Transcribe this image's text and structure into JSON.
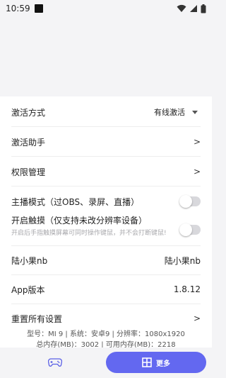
{
  "status_bar": {
    "time": "10:59"
  },
  "settings": {
    "activation_mode": {
      "label": "激活方式",
      "value": "有线激活"
    },
    "activation_helper": {
      "label": "激活助手",
      "chevron": ">"
    },
    "permission_management": {
      "label": "权限管理",
      "chevron": ">"
    },
    "streamer_mode": {
      "label": "主播模式（过OBS、录屏、直播）",
      "enabled": false
    },
    "touch_mode": {
      "label": "开启触摸（仅支持未改分辨率设备）",
      "hint": "开启后手指触摸屏幕可同时操作键鼠，并不会打断键鼠!",
      "enabled": false
    },
    "user": {
      "label": "陆小果nb",
      "value": "陆小果nb"
    },
    "app_version": {
      "label": "App版本",
      "value": "1.8.12"
    },
    "reset_all": {
      "label": "重置所有设置",
      "chevron": ">"
    }
  },
  "device_info": {
    "line1": "型号：MI 9 | 系统：安卓9 | 分辨率：1080x1920",
    "line2": "总内存(MB)：3002 | 可用内存(MB)：2218"
  },
  "bottom_bar": {
    "game_icon": "gamepad-icon",
    "more_icon": "grid-icon",
    "more_label": "更多",
    "accent": "#6368f0"
  }
}
